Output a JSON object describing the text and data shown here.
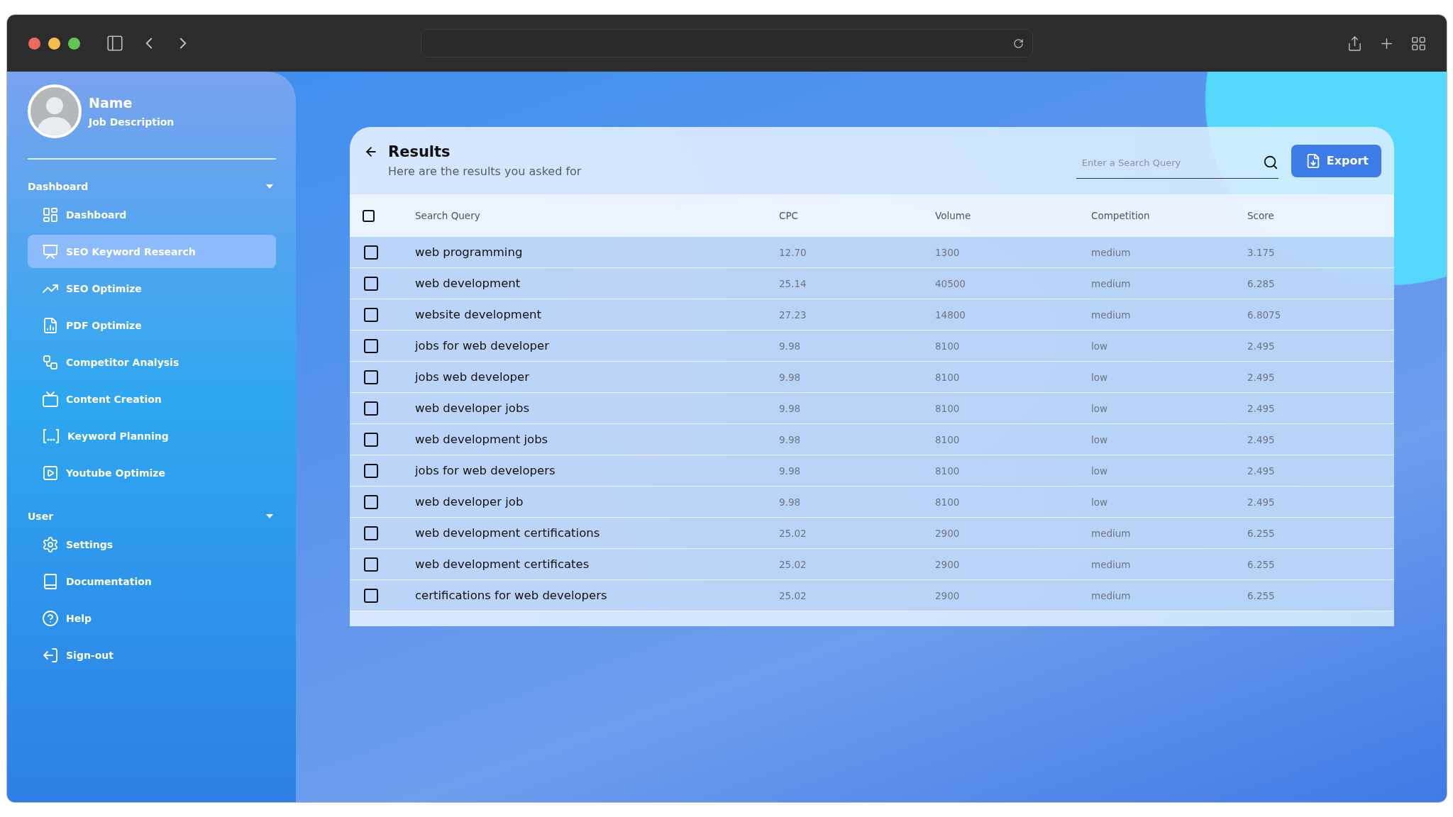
{
  "profile": {
    "name": "Name",
    "description": "Job Description"
  },
  "sidebar": {
    "sections": [
      {
        "title": "Dashboard",
        "expanded": true,
        "items": [
          {
            "label": "Dashboard",
            "selected": false
          },
          {
            "label": "SEO Keyword Research",
            "selected": true
          },
          {
            "label": "SEO Optimize",
            "selected": false
          },
          {
            "label": "PDF Optimize",
            "selected": false
          },
          {
            "label": "Competitor Analysis",
            "selected": false
          },
          {
            "label": "Content Creation",
            "selected": false
          },
          {
            "label": "Keyword Planning",
            "selected": false
          },
          {
            "label": "Youtube Optimize",
            "selected": false
          }
        ]
      },
      {
        "title": "User",
        "expanded": true,
        "items": [
          {
            "label": "Settings",
            "selected": false
          },
          {
            "label": "Documentation",
            "selected": false
          },
          {
            "label": "Help",
            "selected": false
          },
          {
            "label": "Sign-out",
            "selected": false
          }
        ]
      }
    ]
  },
  "results": {
    "title": "Results",
    "subtitle": "Here are the results you asked for",
    "search": {
      "placeholder": "Enter a Search Query"
    },
    "export_label": "Export",
    "table": {
      "all_checked": false,
      "columns": [
        "Search Query",
        "CPC",
        "Volume",
        "Competition",
        "Score"
      ],
      "rows": [
        {
          "checked": false,
          "cells": [
            "web programming",
            "12.70",
            "1300",
            "medium",
            "3.175"
          ]
        },
        {
          "checked": false,
          "cells": [
            "web development",
            "25.14",
            "40500",
            "medium",
            "6.285"
          ]
        },
        {
          "checked": false,
          "cells": [
            "website development",
            "27.23",
            "14800",
            "medium",
            "6.8075"
          ]
        },
        {
          "checked": false,
          "cells": [
            "jobs for web developer",
            "9.98",
            "8100",
            "low",
            "2.495"
          ]
        },
        {
          "checked": false,
          "cells": [
            "jobs web developer",
            "9.98",
            "8100",
            "low",
            "2.495"
          ]
        },
        {
          "checked": false,
          "cells": [
            "web developer jobs",
            "9.98",
            "8100",
            "low",
            "2.495"
          ]
        },
        {
          "checked": false,
          "cells": [
            "web development jobs",
            "9.98",
            "8100",
            "low",
            "2.495"
          ]
        },
        {
          "checked": false,
          "cells": [
            "jobs for web developers",
            "9.98",
            "8100",
            "low",
            "2.495"
          ]
        },
        {
          "checked": false,
          "cells": [
            "web developer job",
            "9.98",
            "8100",
            "low",
            "2.495"
          ]
        },
        {
          "checked": false,
          "cells": [
            "web development certifications",
            "25.02",
            "2900",
            "medium",
            "6.255"
          ]
        },
        {
          "checked": false,
          "cells": [
            "web development certificates",
            "25.02",
            "2900",
            "medium",
            "6.255"
          ]
        },
        {
          "checked": false,
          "cells": [
            "certifications for web developers",
            "25.02",
            "2900",
            "medium",
            "6.255"
          ]
        }
      ]
    }
  }
}
